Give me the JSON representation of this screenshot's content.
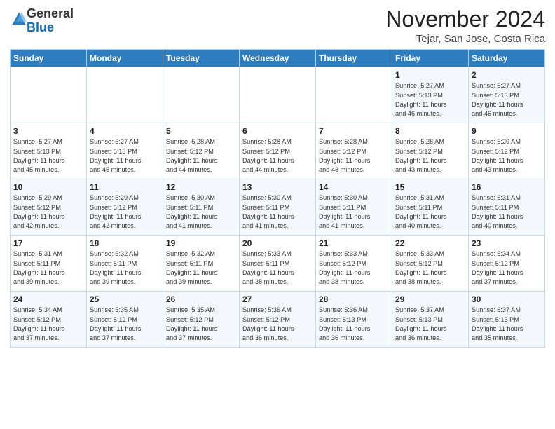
{
  "header": {
    "logo_general": "General",
    "logo_blue": "Blue",
    "month_year": "November 2024",
    "location": "Tejar, San Jose, Costa Rica"
  },
  "days_of_week": [
    "Sunday",
    "Monday",
    "Tuesday",
    "Wednesday",
    "Thursday",
    "Friday",
    "Saturday"
  ],
  "weeks": [
    [
      {
        "day": "",
        "info": ""
      },
      {
        "day": "",
        "info": ""
      },
      {
        "day": "",
        "info": ""
      },
      {
        "day": "",
        "info": ""
      },
      {
        "day": "",
        "info": ""
      },
      {
        "day": "1",
        "info": "Sunrise: 5:27 AM\nSunset: 5:13 PM\nDaylight: 11 hours\nand 46 minutes."
      },
      {
        "day": "2",
        "info": "Sunrise: 5:27 AM\nSunset: 5:13 PM\nDaylight: 11 hours\nand 46 minutes."
      }
    ],
    [
      {
        "day": "3",
        "info": "Sunrise: 5:27 AM\nSunset: 5:13 PM\nDaylight: 11 hours\nand 45 minutes."
      },
      {
        "day": "4",
        "info": "Sunrise: 5:27 AM\nSunset: 5:13 PM\nDaylight: 11 hours\nand 45 minutes."
      },
      {
        "day": "5",
        "info": "Sunrise: 5:28 AM\nSunset: 5:12 PM\nDaylight: 11 hours\nand 44 minutes."
      },
      {
        "day": "6",
        "info": "Sunrise: 5:28 AM\nSunset: 5:12 PM\nDaylight: 11 hours\nand 44 minutes."
      },
      {
        "day": "7",
        "info": "Sunrise: 5:28 AM\nSunset: 5:12 PM\nDaylight: 11 hours\nand 43 minutes."
      },
      {
        "day": "8",
        "info": "Sunrise: 5:28 AM\nSunset: 5:12 PM\nDaylight: 11 hours\nand 43 minutes."
      },
      {
        "day": "9",
        "info": "Sunrise: 5:29 AM\nSunset: 5:12 PM\nDaylight: 11 hours\nand 43 minutes."
      }
    ],
    [
      {
        "day": "10",
        "info": "Sunrise: 5:29 AM\nSunset: 5:12 PM\nDaylight: 11 hours\nand 42 minutes."
      },
      {
        "day": "11",
        "info": "Sunrise: 5:29 AM\nSunset: 5:12 PM\nDaylight: 11 hours\nand 42 minutes."
      },
      {
        "day": "12",
        "info": "Sunrise: 5:30 AM\nSunset: 5:11 PM\nDaylight: 11 hours\nand 41 minutes."
      },
      {
        "day": "13",
        "info": "Sunrise: 5:30 AM\nSunset: 5:11 PM\nDaylight: 11 hours\nand 41 minutes."
      },
      {
        "day": "14",
        "info": "Sunrise: 5:30 AM\nSunset: 5:11 PM\nDaylight: 11 hours\nand 41 minutes."
      },
      {
        "day": "15",
        "info": "Sunrise: 5:31 AM\nSunset: 5:11 PM\nDaylight: 11 hours\nand 40 minutes."
      },
      {
        "day": "16",
        "info": "Sunrise: 5:31 AM\nSunset: 5:11 PM\nDaylight: 11 hours\nand 40 minutes."
      }
    ],
    [
      {
        "day": "17",
        "info": "Sunrise: 5:31 AM\nSunset: 5:11 PM\nDaylight: 11 hours\nand 39 minutes."
      },
      {
        "day": "18",
        "info": "Sunrise: 5:32 AM\nSunset: 5:11 PM\nDaylight: 11 hours\nand 39 minutes."
      },
      {
        "day": "19",
        "info": "Sunrise: 5:32 AM\nSunset: 5:11 PM\nDaylight: 11 hours\nand 39 minutes."
      },
      {
        "day": "20",
        "info": "Sunrise: 5:33 AM\nSunset: 5:11 PM\nDaylight: 11 hours\nand 38 minutes."
      },
      {
        "day": "21",
        "info": "Sunrise: 5:33 AM\nSunset: 5:12 PM\nDaylight: 11 hours\nand 38 minutes."
      },
      {
        "day": "22",
        "info": "Sunrise: 5:33 AM\nSunset: 5:12 PM\nDaylight: 11 hours\nand 38 minutes."
      },
      {
        "day": "23",
        "info": "Sunrise: 5:34 AM\nSunset: 5:12 PM\nDaylight: 11 hours\nand 37 minutes."
      }
    ],
    [
      {
        "day": "24",
        "info": "Sunrise: 5:34 AM\nSunset: 5:12 PM\nDaylight: 11 hours\nand 37 minutes."
      },
      {
        "day": "25",
        "info": "Sunrise: 5:35 AM\nSunset: 5:12 PM\nDaylight: 11 hours\nand 37 minutes."
      },
      {
        "day": "26",
        "info": "Sunrise: 5:35 AM\nSunset: 5:12 PM\nDaylight: 11 hours\nand 37 minutes."
      },
      {
        "day": "27",
        "info": "Sunrise: 5:36 AM\nSunset: 5:12 PM\nDaylight: 11 hours\nand 36 minutes."
      },
      {
        "day": "28",
        "info": "Sunrise: 5:36 AM\nSunset: 5:13 PM\nDaylight: 11 hours\nand 36 minutes."
      },
      {
        "day": "29",
        "info": "Sunrise: 5:37 AM\nSunset: 5:13 PM\nDaylight: 11 hours\nand 36 minutes."
      },
      {
        "day": "30",
        "info": "Sunrise: 5:37 AM\nSunset: 5:13 PM\nDaylight: 11 hours\nand 35 minutes."
      }
    ]
  ]
}
